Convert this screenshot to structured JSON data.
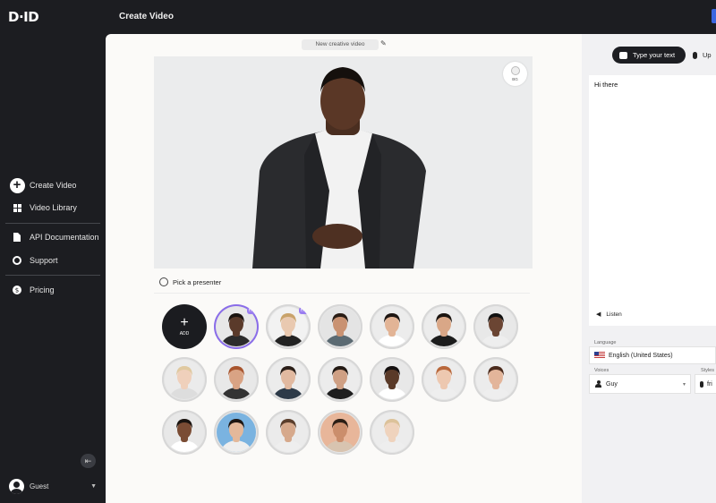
{
  "app": {
    "logo": "D·ID",
    "page_title": "Create Video"
  },
  "sidebar": {
    "primary": [
      {
        "label": "Create Video",
        "icon": "plus-circle-icon"
      },
      {
        "label": "Video Library",
        "icon": "grid-icon"
      }
    ],
    "secondary": [
      {
        "label": "API Documentation",
        "icon": "document-icon"
      },
      {
        "label": "Support",
        "icon": "lifebuoy-icon"
      }
    ],
    "tertiary": [
      {
        "label": "Pricing",
        "icon": "dollar-circle-icon"
      }
    ],
    "user": {
      "name": "Guest"
    }
  },
  "editor": {
    "video_title": "New creative video",
    "background_button": "BG",
    "pick_presenter": "Pick a presenter",
    "add_label": "ADD",
    "badge": "HQ"
  },
  "presenters": [
    {
      "skin": "#5a3a2a",
      "hair": "#1a1410",
      "bg": "#e8e8e8",
      "shirt": "#2c2c2c"
    },
    {
      "skin": "#e9c9b0",
      "hair": "#c9a36a",
      "bg": "#f2f2f2",
      "shirt": "#222"
    },
    {
      "skin": "#c99272",
      "hair": "#2a1d15",
      "bg": "#e4e4e4",
      "shirt": "#5b6a72"
    },
    {
      "skin": "#e2b496",
      "hair": "#1e1612",
      "bg": "#ececec",
      "shirt": "#fff"
    },
    {
      "skin": "#d9a787",
      "hair": "#1b1410",
      "bg": "#ececec",
      "shirt": "#1c1c1c"
    },
    {
      "skin": "#6b4533",
      "hair": "#111",
      "bg": "#e8e8e8",
      "shirt": "#eee"
    },
    {
      "skin": "#efd0bb",
      "hair": "#e0c9a0",
      "bg": "#ebebeb",
      "shirt": "#ddd"
    },
    {
      "skin": "#d9a384",
      "hair": "#a8552e",
      "bg": "#e8e8e8",
      "shirt": "#333"
    },
    {
      "skin": "#e1b9a0",
      "hair": "#2a1e18",
      "bg": "#ececec",
      "shirt": "#2d3a48"
    },
    {
      "skin": "#cfa084",
      "hair": "#231a14",
      "bg": "#ececec",
      "shirt": "#1e1e1e"
    },
    {
      "skin": "#5a3a28",
      "hair": "#151010",
      "bg": "#e8e8e8",
      "shirt": "#fff"
    },
    {
      "skin": "#edc8b0",
      "hair": "#b9683c",
      "bg": "#ececec",
      "shirt": "#eee"
    },
    {
      "skin": "#e3b59a",
      "hair": "#4a2a1c",
      "bg": "#ececec",
      "shirt": "#eee"
    },
    {
      "skin": "#7a4c34",
      "hair": "#1a1410",
      "bg": "#e8e8e8",
      "shirt": "#fff"
    },
    {
      "skin": "#e3b89a",
      "hair": "#1d1612",
      "bg": "#7ab3e0",
      "shirt": "#eee"
    },
    {
      "skin": "#d6a98c",
      "hair": "#5a3e2c",
      "bg": "#ebebeb",
      "shirt": "#eee"
    },
    {
      "skin": "#cb8e6c",
      "hair": "#2b1e15",
      "bg": "#e8b69a",
      "shirt": "#d8c4b0"
    },
    {
      "skin": "#efd3bd",
      "hair": "#dcc29a",
      "bg": "#ececec",
      "shirt": "#eee"
    }
  ],
  "script_panel": {
    "tab_type": "Type your text",
    "tab_upload": "Up",
    "text": "Hi there",
    "listen": "Listen",
    "language_label": "Language",
    "language_value": "English (United States)",
    "voices_label": "Voices",
    "voice_value": "Guy",
    "styles_label": "Styles",
    "style_value": "fri"
  },
  "colors": {
    "sidebar_bg": "#1c1d21",
    "accent": "#8a6de9",
    "canvas_bg": "#fbfaf8"
  }
}
